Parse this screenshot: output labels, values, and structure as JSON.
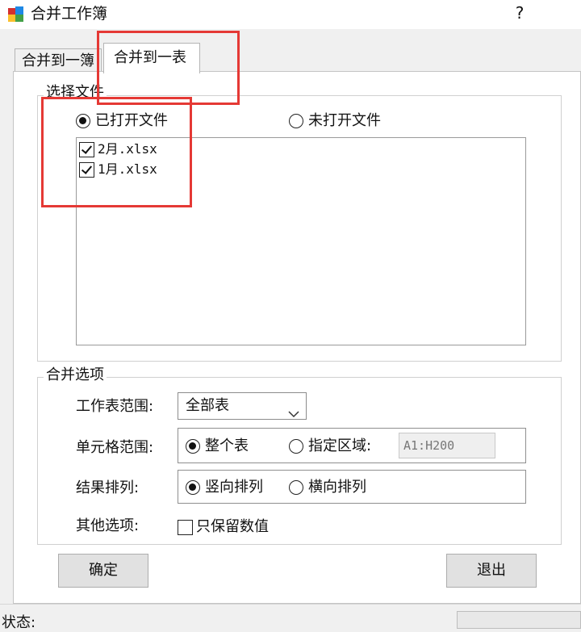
{
  "window": {
    "title": "合并工作簿",
    "help": "?"
  },
  "tabs": [
    {
      "label": "合并到一簿",
      "active": false
    },
    {
      "label": "合并到一表",
      "active": true
    }
  ],
  "file_group": {
    "legend": "选择文件",
    "radio_opened": {
      "label": "已打开文件",
      "checked": true
    },
    "radio_unopened": {
      "label": "未打开文件",
      "checked": false
    },
    "files": [
      {
        "name": "2月.xlsx",
        "checked": true
      },
      {
        "name": "1月.xlsx",
        "checked": true
      }
    ]
  },
  "options_group": {
    "legend": "合并选项",
    "sheet_range": {
      "label": "工作表范围:",
      "value": "全部表"
    },
    "cell_range": {
      "label": "单元格范围:",
      "whole_sheet": {
        "label": "整个表",
        "checked": true
      },
      "specified": {
        "label": "指定区域:",
        "checked": false
      },
      "range_value": "A1:H200"
    },
    "result_order": {
      "label": "结果排列:",
      "vertical": {
        "label": "竖向排列",
        "checked": true
      },
      "horizontal": {
        "label": "横向排列",
        "checked": false
      }
    },
    "other": {
      "label": "其他选项:",
      "values_only": {
        "label": "只保留数值",
        "checked": false
      }
    }
  },
  "buttons": {
    "ok": "确定",
    "exit": "退出"
  },
  "status": {
    "label": "状态:"
  },
  "colors": {
    "highlight": "#e53935"
  },
  "icons": {
    "app": "excel-merge-app-icon",
    "dropdown": "chevron-down-icon"
  }
}
